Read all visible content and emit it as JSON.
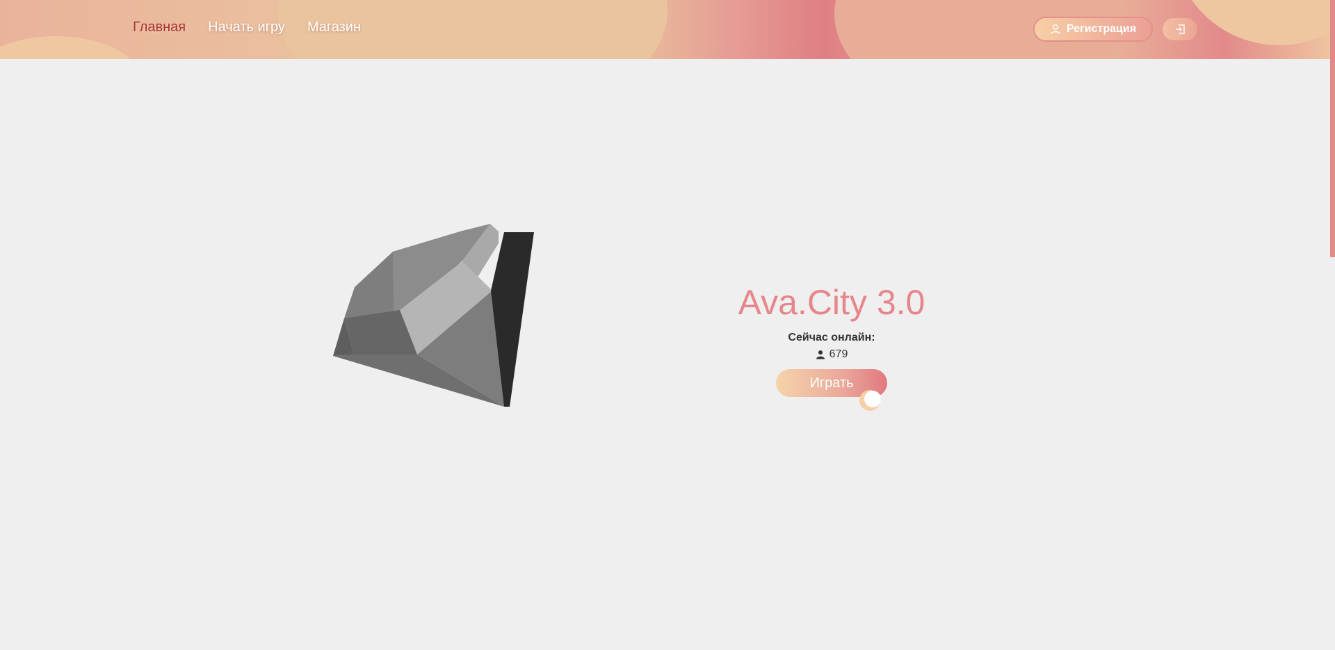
{
  "header": {
    "nav": [
      {
        "label": "Главная",
        "active": true
      },
      {
        "label": "Начать игру",
        "active": false
      },
      {
        "label": "Магазин",
        "active": false
      }
    ],
    "register_label": "Регистрация",
    "register_icon": "user-outline-icon",
    "login_icon": "login-icon"
  },
  "hero": {
    "title": "Ava.City 3.0",
    "online_label": "Сейчас онлайн:",
    "online_icon": "person-icon",
    "online_count": "679",
    "play_label": "Играть",
    "accent_color": "#e6868c"
  },
  "illustration": {
    "icon": "diamond-icon"
  }
}
